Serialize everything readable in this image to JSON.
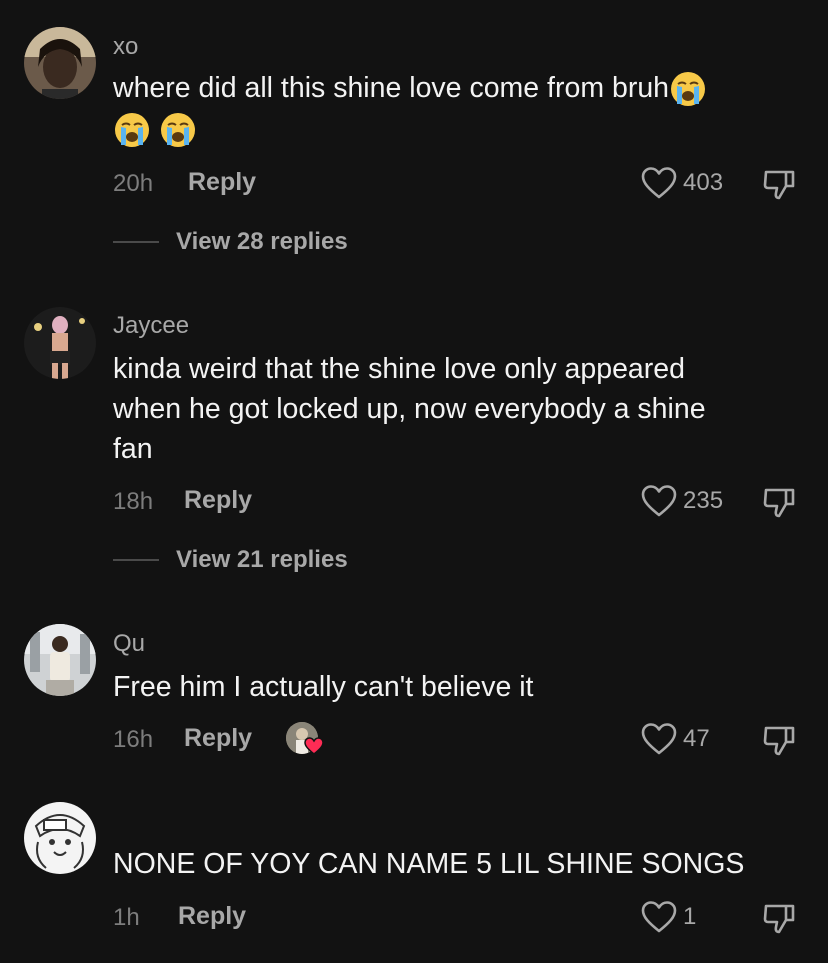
{
  "comments": [
    {
      "username": "xo",
      "text": "where did all this shine love come from bruh",
      "emoji": "loudly-crying-face",
      "time": "20h",
      "reply_label": "Reply",
      "likes": "403",
      "view_replies": "View 28 replies"
    },
    {
      "username": "Jaycee",
      "text_lines": [
        "kinda weird that the shine love only appeared",
        "when he got locked up, now everybody a shine",
        "fan"
      ],
      "time": "18h",
      "reply_label": "Reply",
      "likes": "235",
      "view_replies": "View 21 replies"
    },
    {
      "username": "Qu",
      "text": "Free him I actually can't believe it",
      "time": "16h",
      "reply_label": "Reply",
      "likes": "47"
    },
    {
      "username": "",
      "text": "NONE OF YOY CAN NAME 5 LIL SHINE SONGS",
      "time": "1h",
      "reply_label": "Reply",
      "likes": "1"
    }
  ],
  "colors": {
    "background": "#121212",
    "text": "#f3f3f3",
    "secondary": "#a8a8a8",
    "heart_badge": "#fe2c55"
  }
}
